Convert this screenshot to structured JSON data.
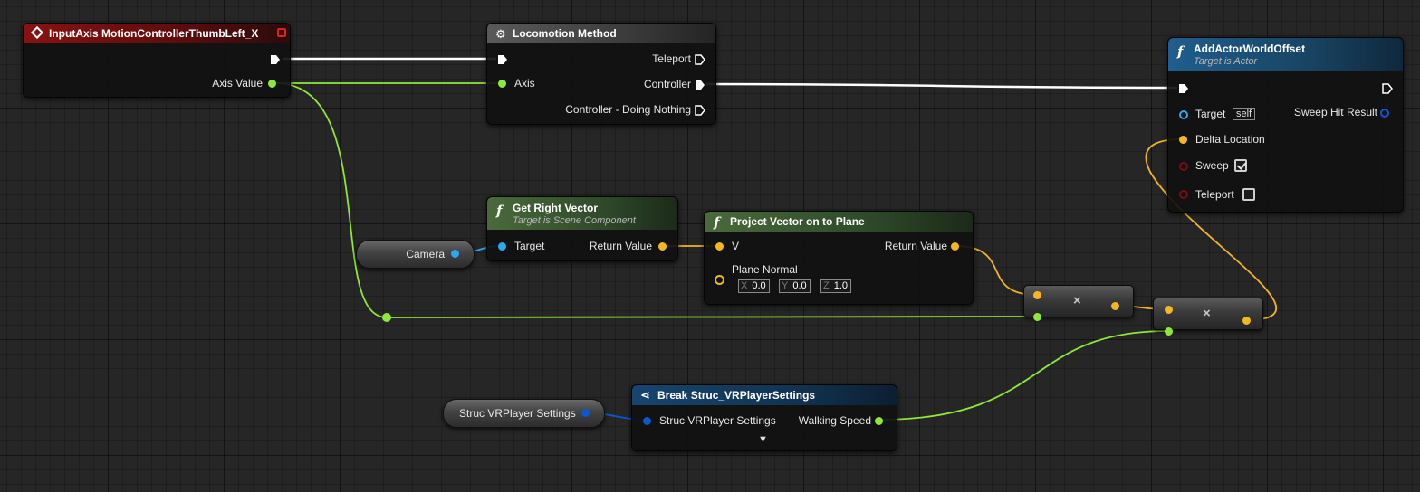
{
  "nodes": {
    "input_axis": {
      "title": "InputAxis MotionControllerThumbLeft_X",
      "pin_axis_value": "Axis Value"
    },
    "locomotion": {
      "title": "Locomotion Method",
      "pin_axis": "Axis",
      "pin_teleport": "Teleport",
      "pin_controller": "Controller",
      "pin_doing_nothing": "Controller - Doing Nothing"
    },
    "add_offset": {
      "title": "AddActorWorldOffset",
      "subtitle": "Target is Actor",
      "pin_target": "Target",
      "self_label": "self",
      "pin_sweep_hit": "Sweep Hit Result",
      "pin_delta": "Delta Location",
      "pin_sweep": "Sweep",
      "sweep_checked": true,
      "pin_teleport": "Teleport",
      "teleport_checked": false
    },
    "get_right": {
      "title": "Get Right Vector",
      "subtitle": "Target is Scene Component",
      "pin_target": "Target",
      "pin_return": "Return Value"
    },
    "camera": {
      "label": "Camera"
    },
    "project": {
      "title": "Project Vector on to Plane",
      "pin_v": "V",
      "pin_return": "Return Value",
      "pin_plane_normal": "Plane Normal",
      "x_axis": "X",
      "x_value": "0.0",
      "y_axis": "Y",
      "y_value": "0.0",
      "z_axis": "Z",
      "z_value": "1.0"
    },
    "multiply": {
      "symbol": "×"
    },
    "struc_var": {
      "label": "Struc VRPlayer Settings"
    },
    "break_struct": {
      "title": "Break Struc_VRPlayerSettings",
      "pin_struct": "Struc VRPlayer Settings",
      "pin_walking": "Walking Speed",
      "expand_symbol": "▼"
    }
  },
  "colors": {
    "float_pin": "#8ee83a",
    "vector_pin": "#f5b622",
    "object_pin": "#2aa8f0",
    "struct_pin": "#0a58cf",
    "bool_pin": "#7a0e0e",
    "exec_wire": "#ffffff"
  }
}
